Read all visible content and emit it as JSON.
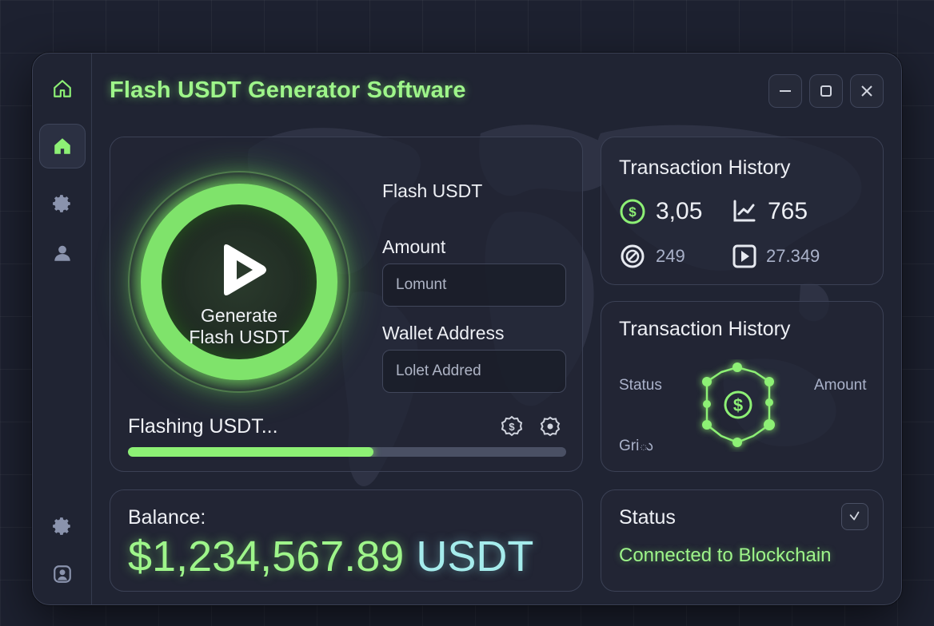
{
  "app": {
    "title": "Flash USDT Generator Software",
    "accent_color": "#9ef58a",
    "cyan_color": "#a5ecec"
  },
  "sidebar": {
    "items": [
      {
        "name": "home-outline-icon"
      },
      {
        "name": "home-icon",
        "active": true
      },
      {
        "name": "gear-icon"
      },
      {
        "name": "user-icon"
      },
      {
        "name": "gear-icon"
      },
      {
        "name": "profile-icon"
      }
    ]
  },
  "window_controls": {
    "minimize": "minimize-icon",
    "maximize": "maximize-icon",
    "close": "close-icon"
  },
  "generator": {
    "button_line1": "Generate",
    "button_line2": "Flash USDT",
    "section_title": "Flash USDT",
    "amount_label": "Amount",
    "amount_placeholder": "Lomunt",
    "wallet_label": "Wallet Address",
    "wallet_placeholder": "Lolet Addred",
    "status_text": "Flashing USDT...",
    "progress": 0.56
  },
  "transaction_history_1": {
    "title": "Transaction History",
    "stats": [
      {
        "icon": "dollar-circle-icon",
        "value": "3,05"
      },
      {
        "icon": "chart-icon",
        "value": "765"
      },
      {
        "icon": "blocked-icon",
        "value": "249"
      },
      {
        "icon": "play-icon",
        "value": "27.349"
      }
    ]
  },
  "transaction_history_2": {
    "title": "Transaction History",
    "label_status": "Status",
    "label_amount": "Amount",
    "label_grid": "Griు"
  },
  "balance": {
    "label": "Balance:",
    "value": "$1,234,567.89",
    "currency": "USDT"
  },
  "status": {
    "title": "Status",
    "text": "Connected to Blockchain",
    "button_icon": "pulse-icon"
  }
}
